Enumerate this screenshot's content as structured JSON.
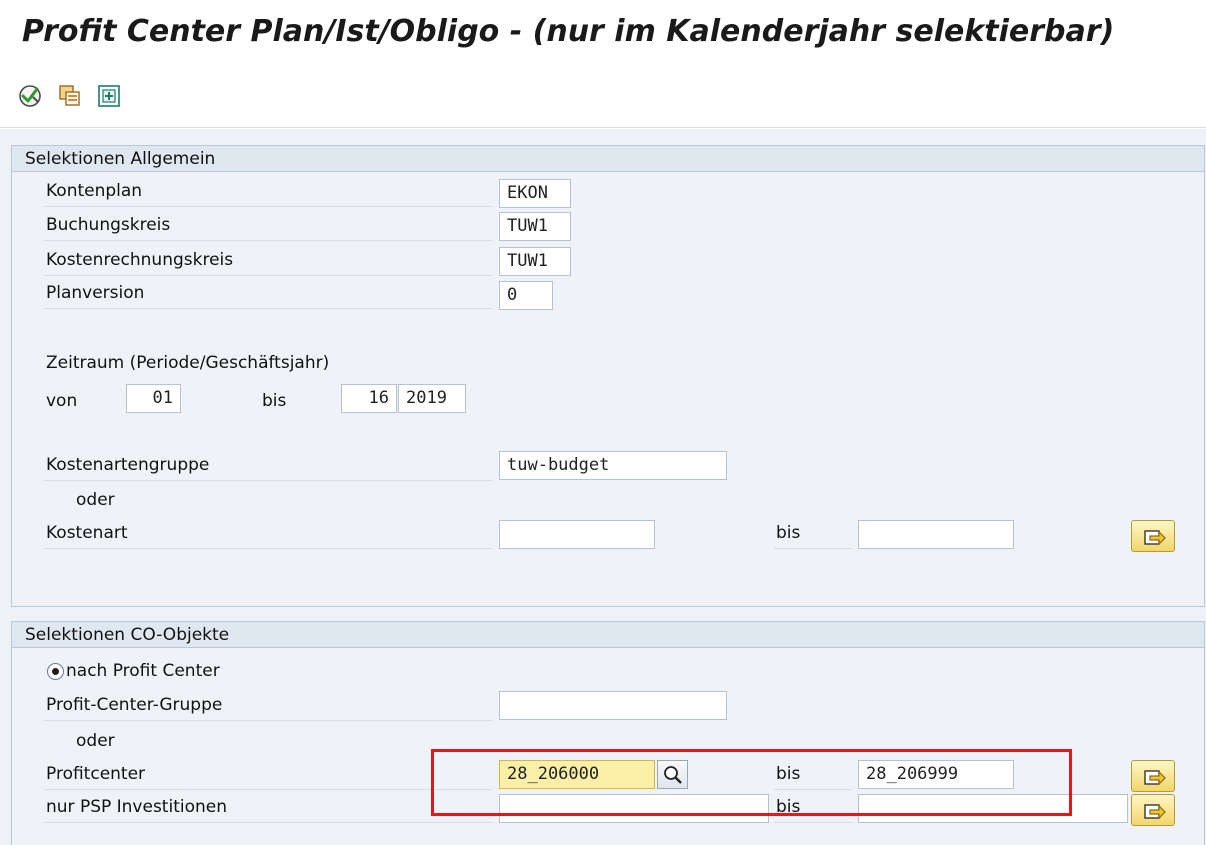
{
  "window": {
    "title": "Profit Center Plan/Ist/Obligo - (nur im Kalenderjahr selektierbar)"
  },
  "toolbar": {
    "buttons": [
      {
        "icon": "execute-icon"
      },
      {
        "icon": "copy-variant-icon"
      },
      {
        "icon": "add-selection-icon"
      }
    ]
  },
  "general": {
    "header": "Selektionen Allgemein",
    "kontenplan": {
      "label": "Kontenplan",
      "value": "EKON"
    },
    "buchungskreis": {
      "label": "Buchungskreis",
      "value": "TUW1"
    },
    "kostenrechnungskreis": {
      "label": "Kostenrechnungskreis",
      "value": "TUW1"
    },
    "planversion": {
      "label": "Planversion",
      "value": "0"
    },
    "zeitraum": {
      "label": "Zeitraum (Periode/Geschäftsjahr)",
      "von_label": "von",
      "von_value": "01",
      "bis_label": "bis",
      "bis_period": "16",
      "bis_year": "2019"
    },
    "kostenartengruppe": {
      "label": "Kostenartengruppe",
      "value": "tuw-budget"
    },
    "oder": "oder",
    "kostenart": {
      "label": "Kostenart",
      "from": "",
      "bis_label": "bis",
      "to": ""
    }
  },
  "co_objects": {
    "header": "Selektionen CO-Objekte",
    "radio_label": "nach Profit Center",
    "pc_gruppe": {
      "label": "Profit-Center-Gruppe",
      "value": ""
    },
    "oder": "oder",
    "profitcenter": {
      "label": "Profitcenter",
      "from": "28_206000",
      "bis_label": "bis",
      "to": "28_206999"
    },
    "psp": {
      "label": "nur PSP Investitionen",
      "from": "",
      "bis_label": "bis",
      "to": ""
    }
  },
  "colors": {
    "group_bg": "#eff3f8",
    "group_header_bg": "#dfe8f1",
    "focus_field": "#fcf0a8",
    "annotation_red": "#e01a1a"
  }
}
